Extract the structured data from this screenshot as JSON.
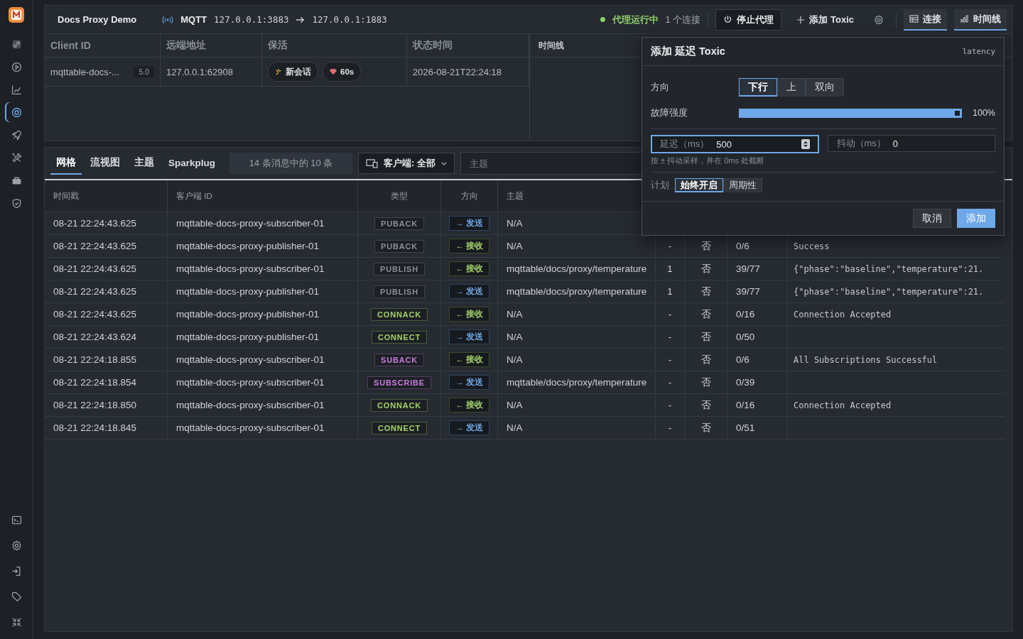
{
  "sidebar": {
    "items": [
      {
        "selected": false
      },
      {
        "selected": false
      },
      {
        "selected": false
      },
      {
        "selected": true
      },
      {
        "selected": false
      },
      {
        "selected": false
      },
      {
        "selected": false
      },
      {
        "selected": false
      }
    ],
    "bottom_items": [
      {
        "selected": false
      },
      {
        "selected": false
      },
      {
        "selected": false
      },
      {
        "selected": false
      },
      {
        "selected": false
      }
    ]
  },
  "header": {
    "title": "Docs Proxy Demo",
    "protocol": "MQTT",
    "listen": "127.0.0.1:3883",
    "upstream": "127.0.0.1:1883",
    "status": "代理运行中",
    "connections": "1 个连接",
    "stop_button": "停止代理",
    "add_button": "添加 Toxic",
    "views": [
      {
        "label": "连接",
        "selected": true
      },
      {
        "label": "时间线",
        "selected": true
      }
    ]
  },
  "connections": {
    "columns": [
      "Client ID",
      "远端地址",
      "保活",
      "状态时间"
    ],
    "rows": [
      {
        "client_id": "mqttable-docs-...",
        "version": "5.0",
        "remote": "127.0.0.1:62908",
        "badges": [
          "新会话",
          "60s"
        ],
        "time": "2026-08-21T22:24:18"
      }
    ]
  },
  "timeline": {
    "title": "时间线"
  },
  "messages": {
    "tabs": [
      {
        "label": "网格",
        "selected": true
      },
      {
        "label": "流视图",
        "selected": false
      },
      {
        "label": "主题",
        "selected": false
      },
      {
        "label": "Sparkplug",
        "selected": false
      }
    ],
    "count": "14 条消息中的 10 条",
    "client_filter": "客户端: 全部",
    "topic_filter": {
      "placeholder": "主题"
    },
    "columns": [
      "时间戳",
      "客户端 ID",
      "类型",
      "方向",
      "主题"
    ],
    "rows": [
      {
        "time": "08-21 22:24:43.625",
        "client": "mqttable-docs-proxy-subscriber-01",
        "type": {
          "label": "PUBACK",
          "color": "#8a8f99"
        },
        "direction": {
          "label": "→ 发送",
          "kind": "out"
        },
        "topic": "N/A"
      },
      {
        "time": "08-21 22:24:43.625",
        "client": "mqttable-docs-proxy-publisher-01",
        "type": {
          "label": "PUBACK",
          "color": "#8a8f99"
        },
        "direction": {
          "label": "← 接收",
          "kind": "in"
        },
        "topic": "N/A",
        "qos": "-",
        "retain": "否",
        "size": "0/6",
        "payload": "Success"
      },
      {
        "time": "08-21 22:24:43.625",
        "client": "mqttable-docs-proxy-subscriber-01",
        "type": {
          "label": "PUBLISH",
          "color": "#8a8f99"
        },
        "direction": {
          "label": "← 接收",
          "kind": "in"
        },
        "topic": "mqttable/docs/proxy/temperature",
        "qos": "1",
        "retain": "否",
        "size": "39/77",
        "payload": "{\"phase\":\"baseline\",\"temperature\":21."
      },
      {
        "time": "08-21 22:24:43.625",
        "client": "mqttable-docs-proxy-publisher-01",
        "type": {
          "label": "PUBLISH",
          "color": "#8a8f99"
        },
        "direction": {
          "label": "→ 发送",
          "kind": "out"
        },
        "topic": "mqttable/docs/proxy/temperature",
        "qos": "1",
        "retain": "否",
        "size": "39/77",
        "payload": "{\"phase\":\"baseline\",\"temperature\":21."
      },
      {
        "time": "08-21 22:24:43.625",
        "client": "mqttable-docs-proxy-publisher-01",
        "type": {
          "label": "CONNACK",
          "color": "#a5d46a"
        },
        "direction": {
          "label": "← 接收",
          "kind": "in"
        },
        "topic": "N/A",
        "qos": "-",
        "retain": "否",
        "size": "0/16",
        "payload": "Connection Accepted"
      },
      {
        "time": "08-21 22:24:43.624",
        "client": "mqttable-docs-proxy-publisher-01",
        "type": {
          "label": "CONNECT",
          "color": "#a5d46a"
        },
        "direction": {
          "label": "→ 发送",
          "kind": "out"
        },
        "topic": "N/A",
        "qos": "-",
        "retain": "否",
        "size": "0/50"
      },
      {
        "time": "08-21 22:24:18.855",
        "client": "mqttable-docs-proxy-subscriber-01",
        "type": {
          "label": "SUBACK",
          "color": "#c77ddb"
        },
        "direction": {
          "label": "← 接收",
          "kind": "in"
        },
        "topic": "N/A",
        "qos": "-",
        "retain": "否",
        "size": "0/6",
        "payload": "All Subscriptions Successful"
      },
      {
        "time": "08-21 22:24:18.854",
        "client": "mqttable-docs-proxy-subscriber-01",
        "type": {
          "label": "SUBSCRIBE",
          "color": "#c77ddb"
        },
        "direction": {
          "label": "→ 发送",
          "kind": "out"
        },
        "topic": "mqttable/docs/proxy/temperature",
        "qos": "-",
        "retain": "否",
        "size": "0/39"
      },
      {
        "time": "08-21 22:24:18.850",
        "client": "mqttable-docs-proxy-subscriber-01",
        "type": {
          "label": "CONNACK",
          "color": "#a5d46a"
        },
        "direction": {
          "label": "← 接收",
          "kind": "in"
        },
        "topic": "N/A",
        "qos": "-",
        "retain": "否",
        "size": "0/16",
        "payload": "Connection Accepted"
      },
      {
        "time": "08-21 22:24:18.845",
        "client": "mqttable-docs-proxy-subscriber-01",
        "type": {
          "label": "CONNECT",
          "color": "#a5d46a"
        },
        "direction": {
          "label": "→ 发送",
          "kind": "out"
        },
        "topic": "N/A",
        "qos": "-",
        "retain": "否",
        "size": "0/51"
      }
    ]
  },
  "dialog": {
    "title": "添加 延迟 Toxic",
    "tag": "latency",
    "direction_label": "方向",
    "directions": [
      {
        "label": "下行",
        "selected": true
      },
      {
        "label": "上",
        "selected": false
      },
      {
        "label": "双向",
        "selected": false
      }
    ],
    "strength_label": "故障强度",
    "strength": {
      "level": 1.0,
      "reading": "100%"
    },
    "fields": [
      {
        "label": "延迟（ms）",
        "value": "500",
        "focused": true,
        "kind": "number"
      },
      {
        "label": "抖动（ms）",
        "value": "0",
        "focused": false,
        "kind": "text"
      }
    ],
    "hint": "按 ± 抖动采样，并在 0ms 处截断",
    "schedule_label": "计划",
    "schedules": [
      {
        "label": "始终开启",
        "selected": true
      },
      {
        "label": "周期性",
        "selected": false
      }
    ],
    "cancel": "取消",
    "submit": "添加"
  }
}
